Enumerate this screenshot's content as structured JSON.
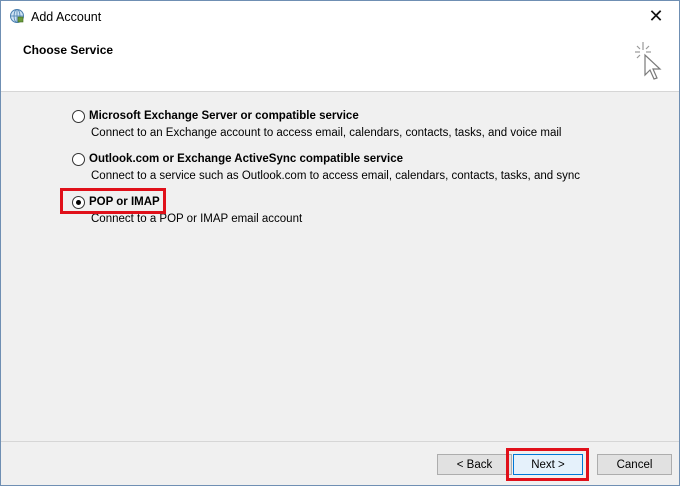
{
  "window": {
    "title": "Add Account",
    "close_glyph": "✕"
  },
  "header": {
    "title": "Choose Service"
  },
  "options": [
    {
      "label": "Microsoft Exchange Server or compatible service",
      "description": "Connect to an Exchange account to access email, calendars, contacts, tasks, and voice mail",
      "selected": false
    },
    {
      "label": "Outlook.com or Exchange ActiveSync compatible service",
      "description": "Connect to a service such as Outlook.com to access email, calendars, contacts, tasks, and sync",
      "selected": false
    },
    {
      "label": "POP or IMAP",
      "description": "Connect to a POP or IMAP email account",
      "selected": true
    }
  ],
  "buttons": {
    "back": "< Back",
    "next": "Next >",
    "cancel": "Cancel"
  },
  "colors": {
    "highlight": "#e0101a",
    "accent": "#0078d7"
  },
  "icons": {
    "app": "globe-icon",
    "wizard": "cursor-sparkle-icon",
    "close": "close-icon"
  }
}
